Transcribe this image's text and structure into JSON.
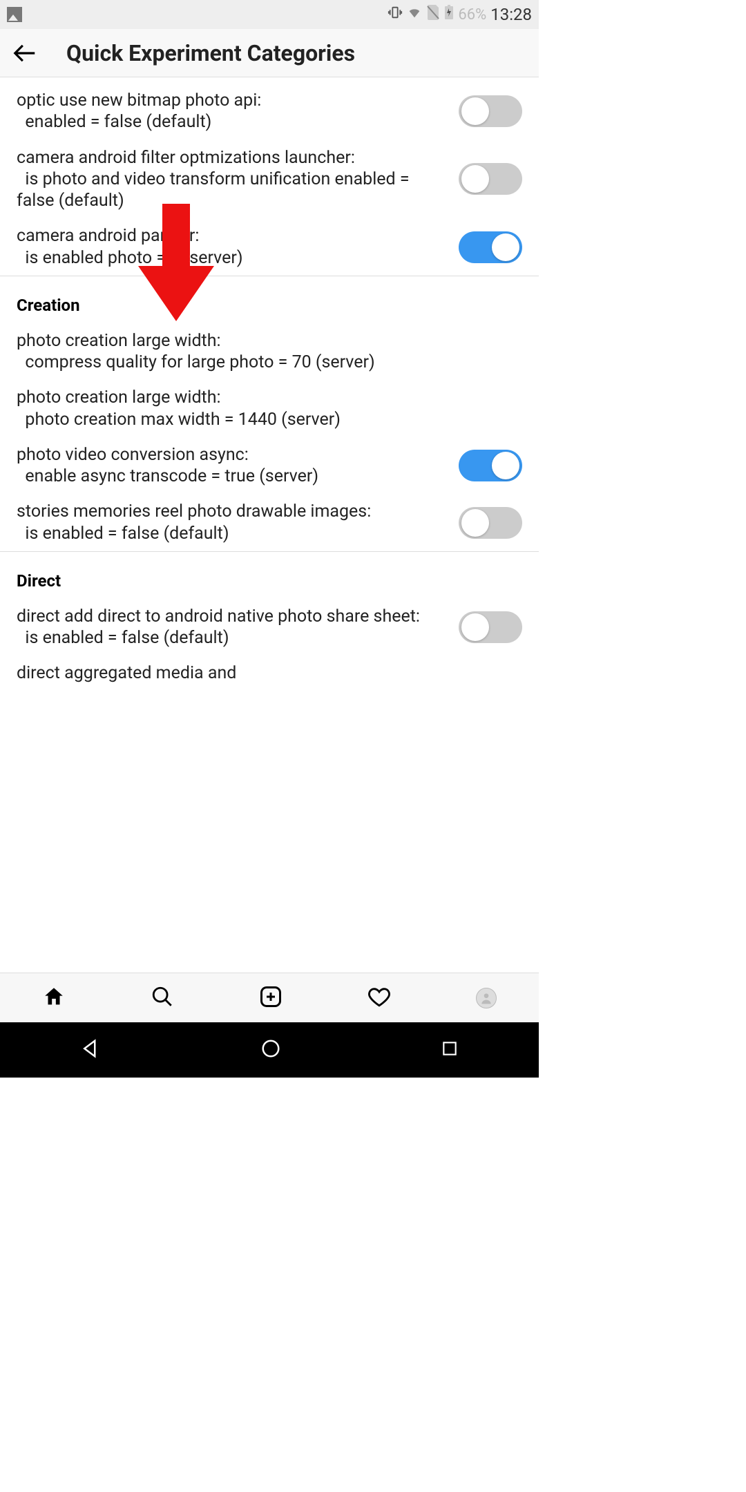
{
  "status_bar": {
    "battery_percent": "66%",
    "time": "13:28"
  },
  "header": {
    "title": "Quick Experiment Categories"
  },
  "settings_top": [
    {
      "title": "optic use new bitmap photo api:",
      "sub": "enabled = false (default)",
      "has_toggle": true,
      "toggle_on": false
    },
    {
      "title": "camera android filter optmizations launcher:",
      "sub": "is photo and video transform unification enabled = false (default)",
      "has_toggle": true,
      "toggle_on": false
    },
    {
      "title": "camera android par     lter:",
      "sub": "is enabled photo =     e (server)",
      "has_toggle": true,
      "toggle_on": true
    }
  ],
  "sections": [
    {
      "name": "Creation",
      "items": [
        {
          "title": "photo creation large width:",
          "sub": "compress quality for large photo = 70 (server)",
          "has_toggle": false
        },
        {
          "title": "photo creation large width:",
          "sub": "photo creation max width = 1440 (server)",
          "has_toggle": false
        },
        {
          "title": "photo video conversion async:",
          "sub": "enable async transcode = true (server)",
          "has_toggle": true,
          "toggle_on": true
        },
        {
          "title": "stories memories reel photo drawable images:",
          "sub": "is enabled = false (default)",
          "has_toggle": true,
          "toggle_on": false
        }
      ]
    },
    {
      "name": "Direct",
      "items": [
        {
          "title": "direct add direct to android native photo share sheet:",
          "sub": "is enabled = false (default)",
          "has_toggle": true,
          "toggle_on": false
        },
        {
          "title": "direct aggregated media and",
          "sub": "",
          "has_toggle": false,
          "cutoff": true
        }
      ]
    }
  ]
}
